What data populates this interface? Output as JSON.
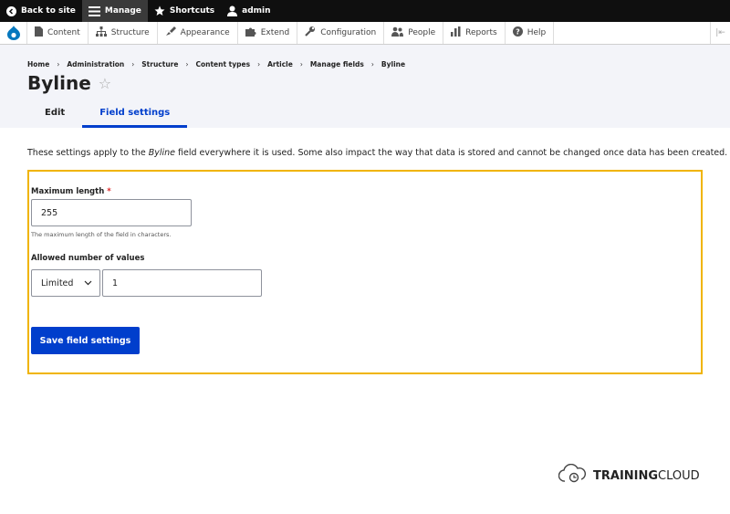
{
  "toolbar": {
    "back_label": "Back to site",
    "manage_label": "Manage",
    "shortcuts_label": "Shortcuts",
    "user_label": "admin"
  },
  "tray": {
    "items": [
      "Content",
      "Structure",
      "Appearance",
      "Extend",
      "Configuration",
      "People",
      "Reports",
      "Help"
    ]
  },
  "breadcrumb": {
    "items": [
      "Home",
      "Administration",
      "Structure",
      "Content types",
      "Article",
      "Manage fields",
      "Byline"
    ],
    "separator": "›"
  },
  "page": {
    "title": "Byline",
    "star": "☆"
  },
  "tabs": [
    {
      "label": "Edit",
      "active": false
    },
    {
      "label": "Field settings",
      "active": true
    }
  ],
  "intro": {
    "before": "These settings apply to the ",
    "field": "Byline",
    "after": " field everywhere it is used. Some also impact the way that data is stored and cannot be changed once data has been created."
  },
  "form": {
    "max_length_label": "Maximum length",
    "required_mark": "*",
    "max_length_value": "255",
    "max_length_desc": "The maximum length of the field in characters.",
    "cardinality_label": "Allowed number of values",
    "cardinality_select": "Limited",
    "cardinality_value": "1",
    "save_label": "Save field settings"
  },
  "brand": {
    "bold": "TRAINING",
    "rest": "CLOUD"
  },
  "colors": {
    "accent": "#003ecc",
    "highlight": "#f0b400",
    "toolbar_bg": "#0f0f0f"
  }
}
